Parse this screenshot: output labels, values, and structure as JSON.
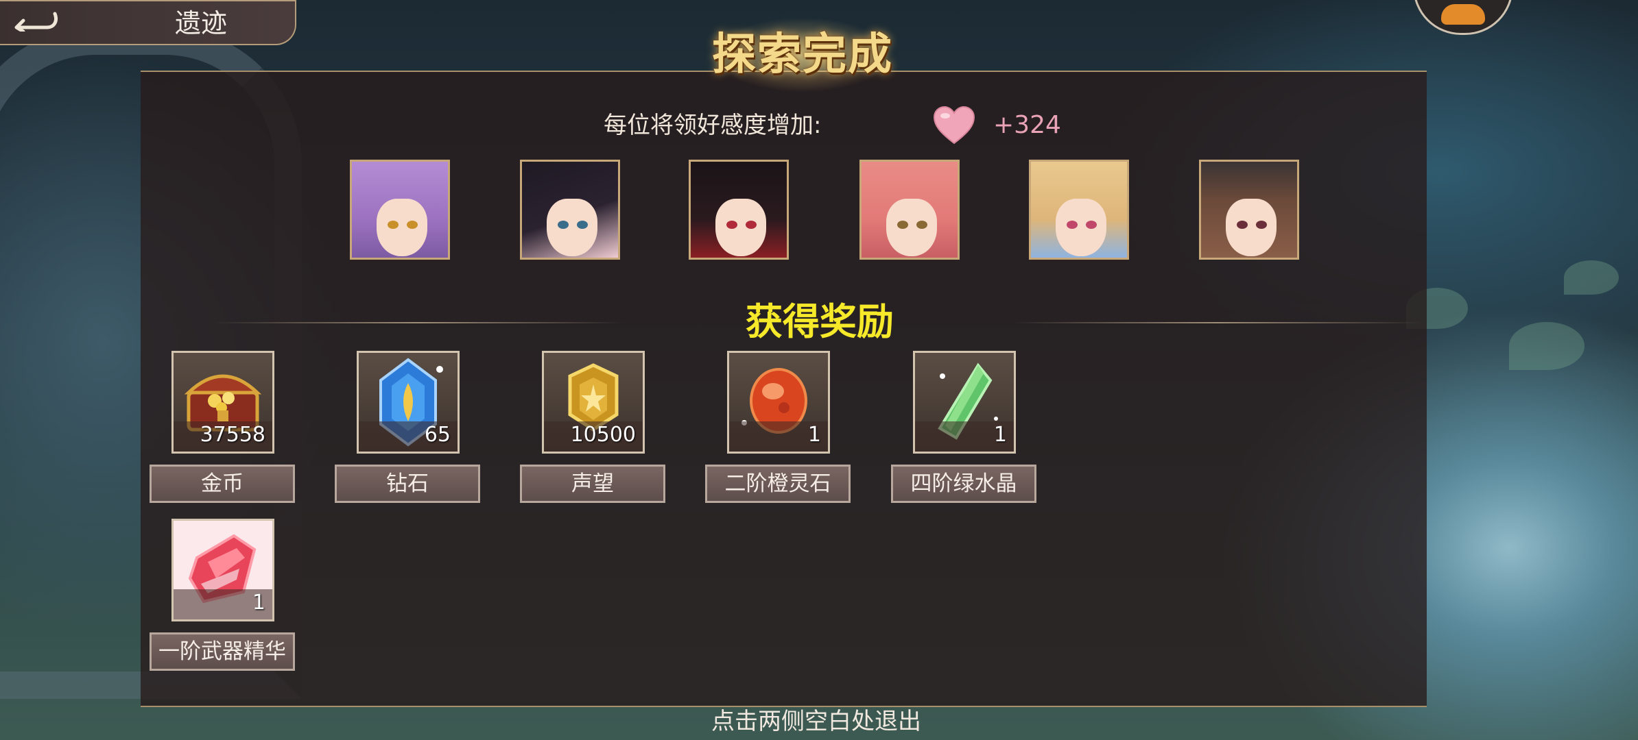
{
  "header": {
    "back_title": "遗迹",
    "panel_title": "探索完成"
  },
  "affection": {
    "label": "每位将领好感度增加:",
    "value": "+324"
  },
  "rewards_title": "获得奖励",
  "rewards": [
    {
      "name": "金币",
      "count": "37558",
      "icon": "treasure-chest-icon"
    },
    {
      "name": "钻石",
      "count": "65",
      "icon": "blue-crystal-icon"
    },
    {
      "name": "声望",
      "count": "10500",
      "icon": "gold-badge-icon"
    },
    {
      "name": "二阶橙灵石",
      "count": "1",
      "icon": "orange-spirit-stone-icon"
    },
    {
      "name": "四阶绿水晶",
      "count": "1",
      "icon": "green-crystal-icon"
    },
    {
      "name": "一阶武器精华",
      "count": "1",
      "icon": "red-weapon-essence-icon"
    }
  ],
  "footer_hint": "点击两侧空白处退出",
  "colors": {
    "title_gold": "#f4d98a",
    "rewards_title_yellow": "#f5e92a",
    "affection_value_pink": "#e9a2b6",
    "panel_border": "#a8906a"
  }
}
